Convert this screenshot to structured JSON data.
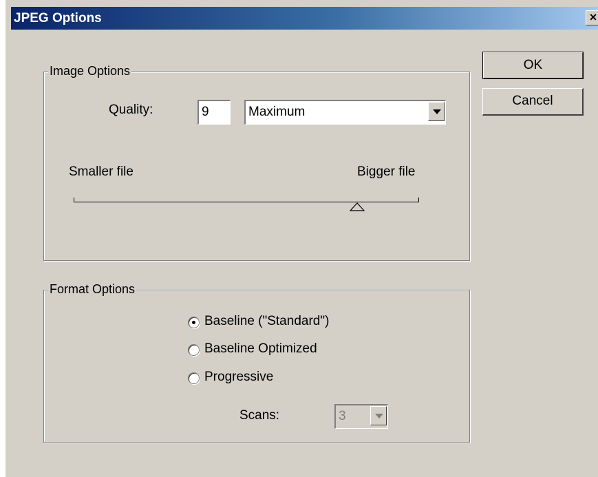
{
  "window": {
    "title": "JPEG Options",
    "close_glyph": "×"
  },
  "buttons": {
    "ok": "OK",
    "cancel": "Cancel"
  },
  "image_options": {
    "group_label": "Image Options",
    "quality_label": "Quality:",
    "quality_value": "9",
    "quality_preset": "Maximum",
    "slider_left_label": "Smaller file",
    "slider_right_label": "Bigger file",
    "slider_fraction": 0.82
  },
  "format_options": {
    "group_label": "Format Options",
    "radios": [
      {
        "label": "Baseline (\"Standard\")",
        "checked": true
      },
      {
        "label": "Baseline Optimized",
        "checked": false
      },
      {
        "label": "Progressive",
        "checked": false
      }
    ],
    "scans_label": "Scans:",
    "scans_value": "3"
  }
}
